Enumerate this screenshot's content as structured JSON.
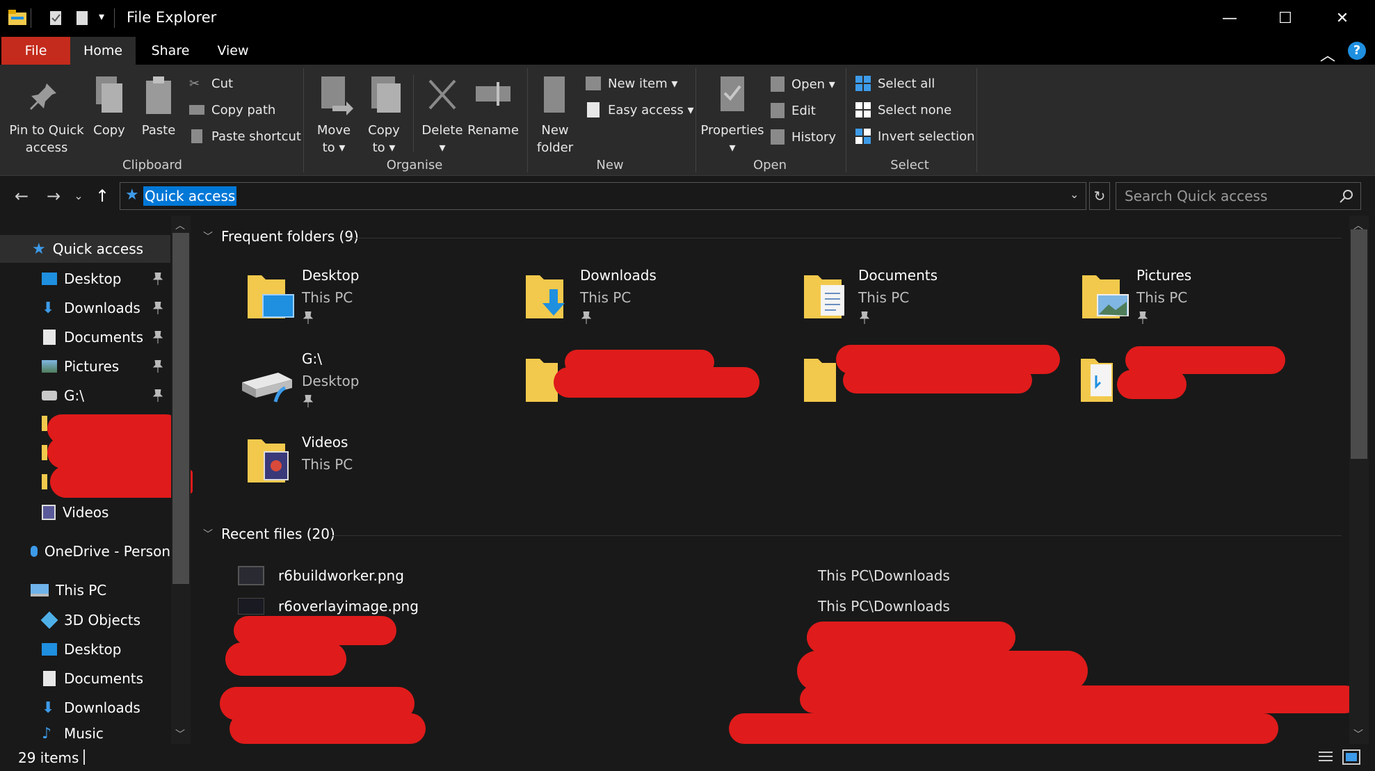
{
  "window": {
    "title": "File Explorer"
  },
  "tabs": {
    "file": "File",
    "home": "Home",
    "share": "Share",
    "view": "View"
  },
  "ribbon": {
    "clipboard": {
      "label": "Clipboard",
      "pin": [
        "Pin to Quick",
        "access"
      ],
      "copy": "Copy",
      "paste": "Paste",
      "cut": "Cut",
      "copy_path": "Copy path",
      "paste_shortcut": "Paste shortcut"
    },
    "organise": {
      "label": "Organise",
      "move_to": [
        "Move",
        "to ▾"
      ],
      "copy_to": [
        "Copy",
        "to ▾"
      ],
      "delete": [
        "Delete",
        "▾"
      ],
      "rename": "Rename"
    },
    "new": {
      "label": "New",
      "new_folder": [
        "New",
        "folder"
      ],
      "new_item": "New item ▾",
      "easy_access": "Easy access ▾"
    },
    "open": {
      "label": "Open",
      "properties": [
        "Properties",
        "▾"
      ],
      "open": "Open ▾",
      "edit": "Edit",
      "history": "History"
    },
    "select": {
      "label": "Select",
      "select_all": "Select all",
      "select_none": "Select none",
      "invert": "Invert selection"
    }
  },
  "nav": {
    "address": "Quick access",
    "search_placeholder": "Search Quick access"
  },
  "sidebar": {
    "quick_access": "Quick access",
    "items": [
      "Desktop",
      "Downloads",
      "Documents",
      "Pictures",
      "G:\\",
      "Videos"
    ],
    "onedrive": "OneDrive - Person",
    "this_pc": "This PC",
    "pc_items": [
      "3D Objects",
      "Desktop",
      "Documents",
      "Downloads",
      "Music"
    ]
  },
  "frequent": {
    "header": "Frequent folders (9)",
    "tiles": [
      {
        "name": "Desktop",
        "sub": "This PC"
      },
      {
        "name": "Downloads",
        "sub": "This PC"
      },
      {
        "name": "Documents",
        "sub": "This PC"
      },
      {
        "name": "Pictures",
        "sub": "This PC"
      },
      {
        "name": "G:\\",
        "sub": "Desktop"
      },
      {
        "name": "Videos",
        "sub": "This PC"
      }
    ]
  },
  "recent": {
    "header": "Recent files (20)",
    "files": [
      {
        "name": "r6buildworker.png",
        "path": "This PC\\Downloads"
      },
      {
        "name": "r6overlayimage.png",
        "path": "This PC\\Downloads"
      }
    ]
  },
  "status": {
    "items": "29 items"
  },
  "colors": {
    "accent": "#0078d7",
    "file_tab": "#c42b1c",
    "folder": "#f2c94c",
    "redaction": "#e01b1b"
  }
}
